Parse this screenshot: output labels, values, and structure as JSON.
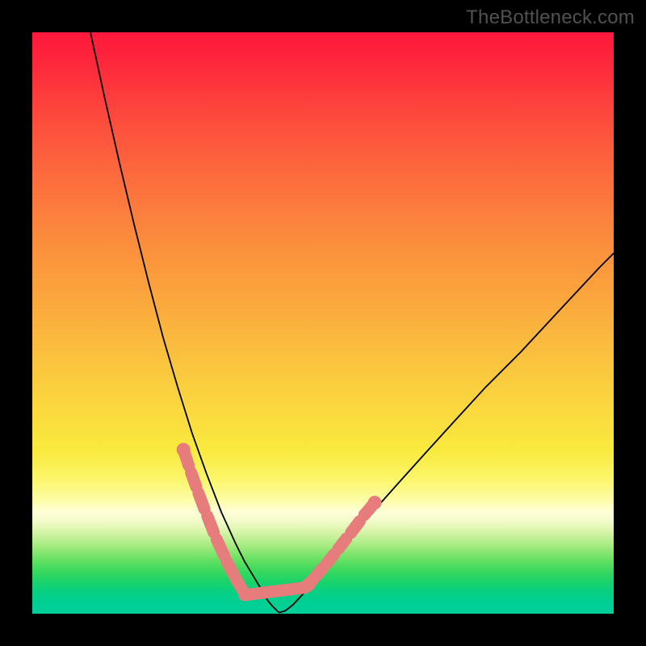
{
  "watermark": "TheBottleneck.com",
  "colors": {
    "background": "#000000",
    "pink_overlay": "#e77c7c",
    "curve_stroke": "#000000"
  },
  "chart_data": {
    "type": "line",
    "title": "",
    "xlabel": "",
    "ylabel": "",
    "xlim": [
      0,
      100
    ],
    "ylim": [
      0,
      100
    ],
    "legend": false,
    "grid": false,
    "series": [
      {
        "name": "left-curve",
        "x": [
          10,
          12.5,
          15,
          17.5,
          20,
          22.5,
          25,
          27.5,
          30,
          32.5,
          35,
          36.5,
          38,
          39.2,
          40,
          40.7,
          41.3,
          41.8,
          42.2,
          42.5
        ],
        "y": [
          100,
          88.5,
          77.5,
          67,
          57,
          47.5,
          39,
          31,
          24,
          17.5,
          12,
          9,
          6.5,
          4.5,
          3,
          2,
          1.3,
          0.8,
          0.4,
          0.2
        ]
      },
      {
        "name": "right-curve",
        "x": [
          42.5,
          43.5,
          44.8,
          46.2,
          48,
          50,
          52.5,
          55.5,
          59,
          63,
          67.5,
          72.5,
          78,
          84,
          90.5,
          97.5,
          100
        ],
        "y": [
          0.2,
          0.5,
          1.5,
          3,
          5,
          7.5,
          10.5,
          14,
          18,
          22.5,
          27.5,
          33,
          39,
          45,
          52,
          59.5,
          62
        ]
      }
    ],
    "annotations": [
      {
        "name": "pink-overlay",
        "type": "dashed-stroke",
        "segments_left_x": [
          26.0,
          26.9,
          27.3,
          28.2,
          28.6,
          29.6,
          30.1,
          31.2,
          31.7,
          33.0,
          33.4,
          34.6,
          35.0,
          36.2
        ],
        "segments_left_y": [
          28.2,
          25.5,
          24.3,
          21.8,
          20.7,
          18.0,
          16.8,
          14.0,
          12.8,
          10.0,
          9.0,
          6.8,
          6.0,
          4.0
        ],
        "segments_right_x": [
          47.5,
          48.3,
          48.9,
          50.0,
          50.7,
          51.9,
          52.6,
          54.0,
          54.8,
          56.3,
          57.1,
          58.9
        ],
        "segments_right_y": [
          5.0,
          5.9,
          6.6,
          7.9,
          8.7,
          10.2,
          11.1,
          12.9,
          13.9,
          15.9,
          17.0,
          19.1
        ],
        "bottom_segment_x": [
          36.5,
          47.0
        ],
        "bottom_segment_y": [
          3.2,
          4.5
        ],
        "dots_x": [
          26.0,
          47.5,
          58.9
        ],
        "dots_y": [
          28.2,
          5.0,
          19.1
        ]
      }
    ]
  }
}
